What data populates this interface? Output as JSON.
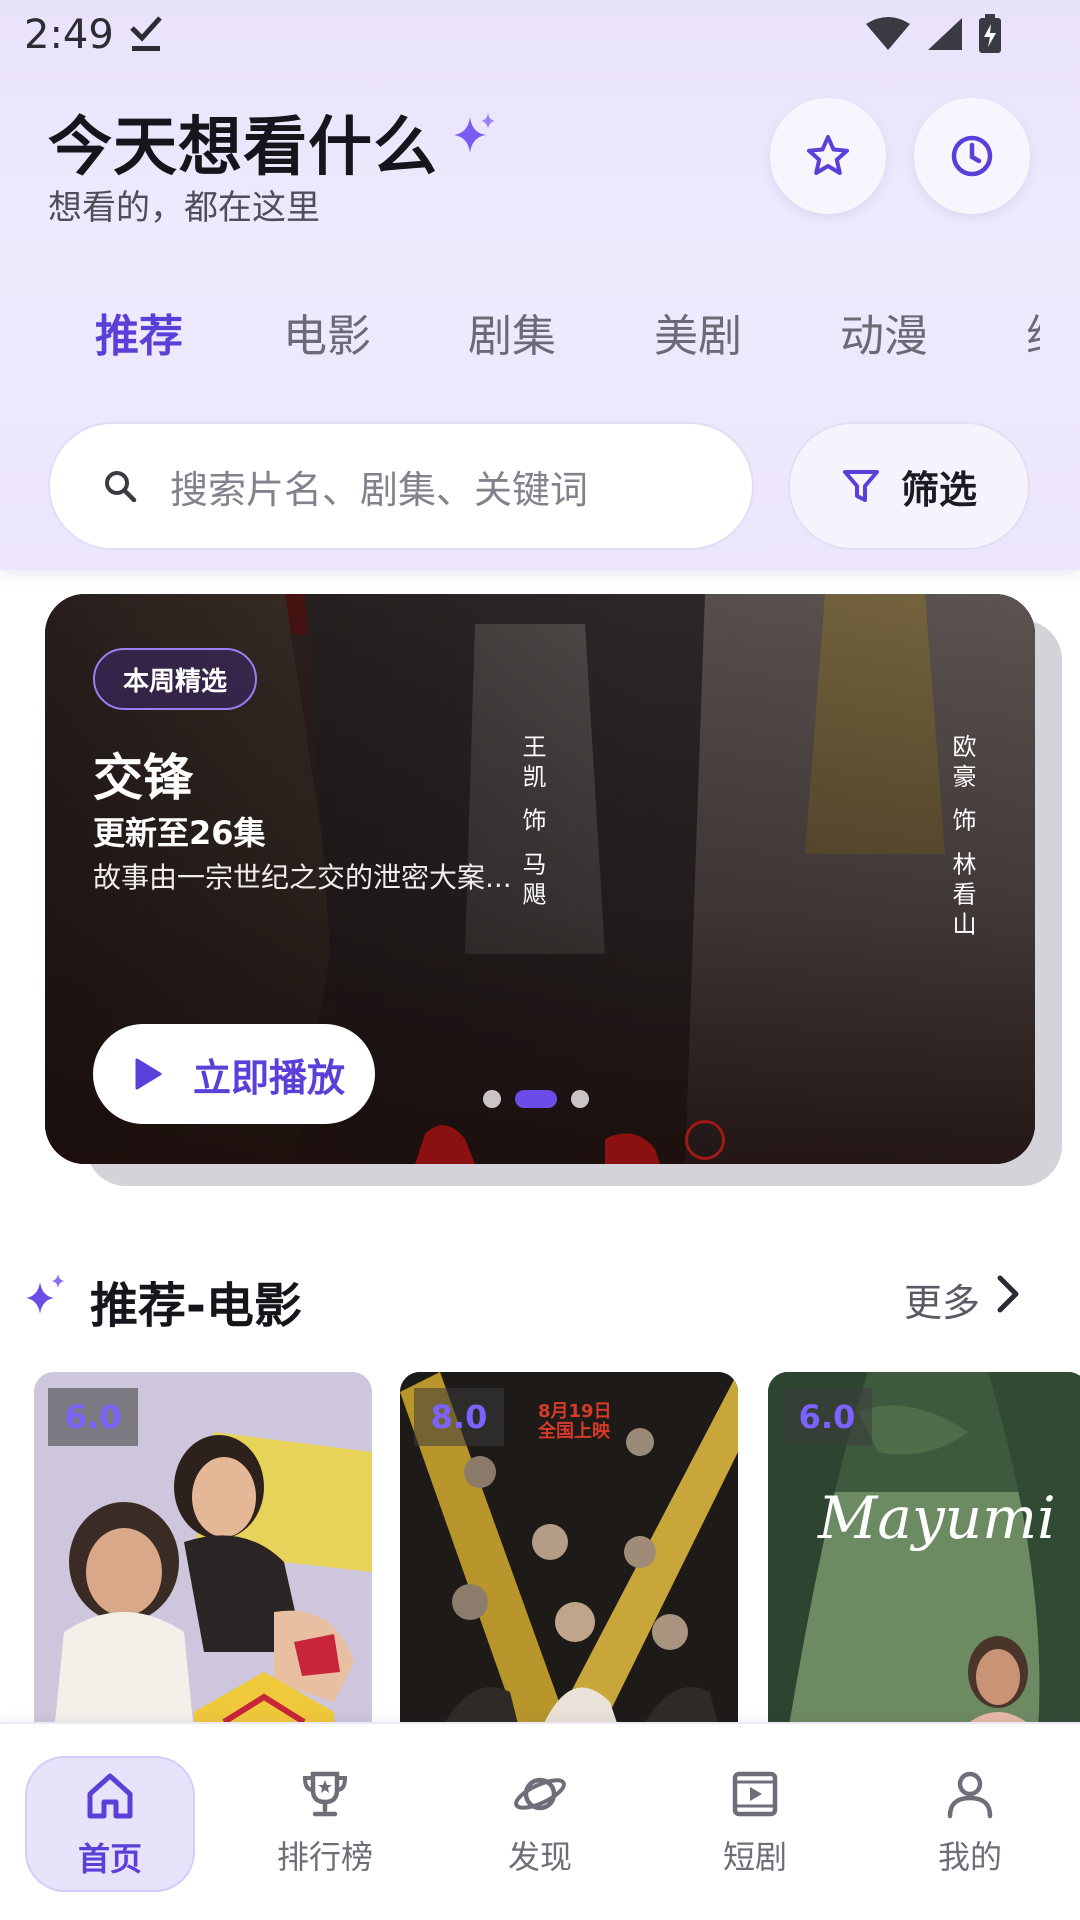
{
  "status": {
    "time": "2:49"
  },
  "header": {
    "title": "今天想看什么",
    "subtitle": "想看的，都在这里"
  },
  "tabs": [
    {
      "label": "推荐",
      "active": true
    },
    {
      "label": "电影",
      "active": false
    },
    {
      "label": "剧集",
      "active": false
    },
    {
      "label": "美剧",
      "active": false
    },
    {
      "label": "动漫",
      "active": false
    }
  ],
  "search": {
    "placeholder": "搜索片名、剧集、关键词"
  },
  "filter": {
    "label": "筛选"
  },
  "banner": {
    "badge": "本周精选",
    "title": "交锋",
    "episode": "更新至26集",
    "description": "故事由一宗世纪之交的泄密大案...",
    "play_label": "立即播放",
    "actor_tags": [
      "王凯 饰 马飓",
      "欧豪 饰 林看山"
    ],
    "page_count": 3,
    "active_page": 2
  },
  "section": {
    "title": "推荐-电影",
    "more_label": "更多"
  },
  "movies": [
    {
      "rating": "6.0"
    },
    {
      "rating": "8.0"
    },
    {
      "rating": "6.0",
      "poster_text": "Mayumi"
    }
  ],
  "poster2_text": {
    "line1": "8月19日",
    "line2": "全国上映"
  },
  "nav": [
    {
      "label": "首页",
      "icon": "home-icon",
      "active": true
    },
    {
      "label": "排行榜",
      "icon": "trophy-icon",
      "active": false
    },
    {
      "label": "发现",
      "icon": "planet-icon",
      "active": false
    },
    {
      "label": "短剧",
      "icon": "video-icon",
      "active": false
    },
    {
      "label": "我的",
      "icon": "user-icon",
      "active": false
    }
  ],
  "colors": {
    "accent": "#5b3fd9",
    "header_bg": "#ece5fc",
    "rating": "#7c62ff"
  }
}
